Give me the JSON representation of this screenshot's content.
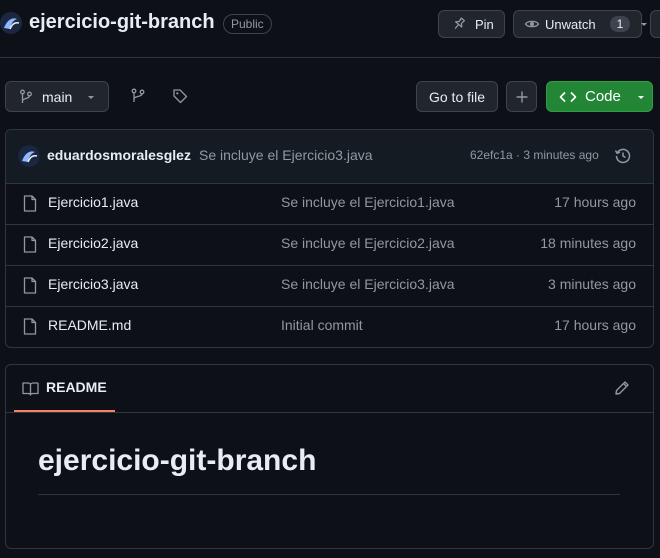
{
  "repo": {
    "name": "ejercicio-git-branch",
    "visibility": "Public",
    "avatar_icon": "avatar-icon"
  },
  "header_actions": {
    "pin_label": "Pin",
    "unwatch_label": "Unwatch",
    "watch_count": "1"
  },
  "toolbar": {
    "branch": "main",
    "go_to_file": "Go to file",
    "add_icon": "plus-icon",
    "code_label": "Code"
  },
  "latest_commit": {
    "author": "eduardosmoralesglez",
    "message": "Se incluye el Ejercicio3.java",
    "hash": "62efc1a",
    "separator": "·",
    "time": "3 minutes ago"
  },
  "files": [
    {
      "name": "Ejercicio1.java",
      "message": "Se incluye el Ejercicio1.java",
      "time": "17 hours ago"
    },
    {
      "name": "Ejercicio2.java",
      "message": "Se incluye el Ejercicio2.java",
      "time": "18 minutes ago"
    },
    {
      "name": "Ejercicio3.java",
      "message": "Se incluye el Ejercicio3.java",
      "time": "3 minutes ago"
    },
    {
      "name": "README.md",
      "message": "Initial commit",
      "time": "17 hours ago"
    }
  ],
  "readme": {
    "tab_label": "README",
    "heading": "ejercicio-git-branch"
  },
  "colors": {
    "background": "#0d1117",
    "border": "#30363d",
    "code_button": "#238636",
    "readme_underline": "#f78166"
  }
}
